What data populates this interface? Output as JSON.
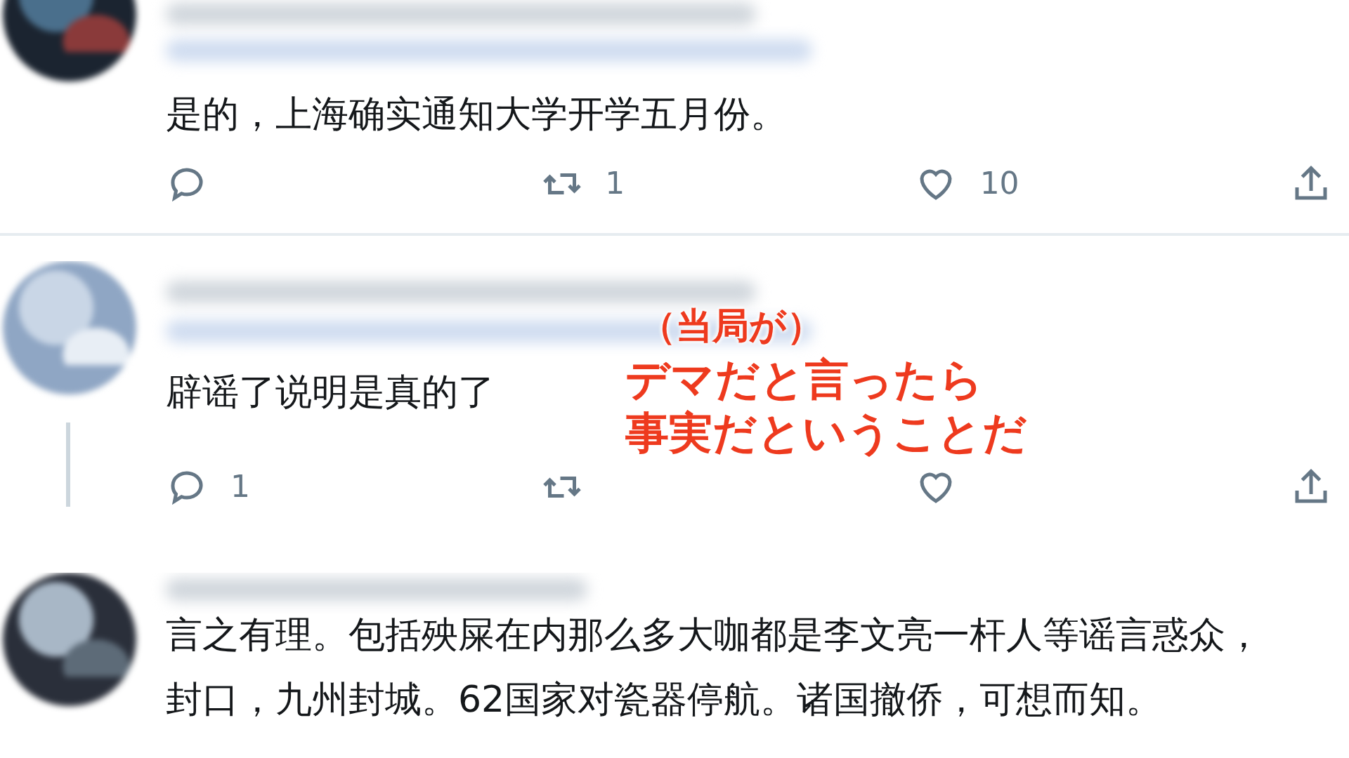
{
  "replies": [
    {
      "text": "是的，上海确实通知大学开学五月份。",
      "actions": [
        {
          "kind": "reply"
        },
        {
          "kind": "retweet",
          "count": "1"
        },
        {
          "kind": "like",
          "count": "10"
        },
        {
          "kind": "share"
        }
      ]
    },
    {
      "thread_line": true,
      "text": "辟谣了说明是真的了",
      "actions": [
        {
          "kind": "reply",
          "count": "1"
        },
        {
          "kind": "retweet"
        },
        {
          "kind": "like"
        },
        {
          "kind": "share"
        }
      ]
    },
    {
      "text": "言之有理。包括殃屎在内那么多大咖都是李文亮一杆人等谣言惑众，封口，九州封城。62国家对瓷器停航。诸国撤侨，可想而知。"
    }
  ],
  "caption": {
    "lines": [
      "（当局が）",
      "デマだと言ったら",
      "事実だということだ"
    ]
  }
}
